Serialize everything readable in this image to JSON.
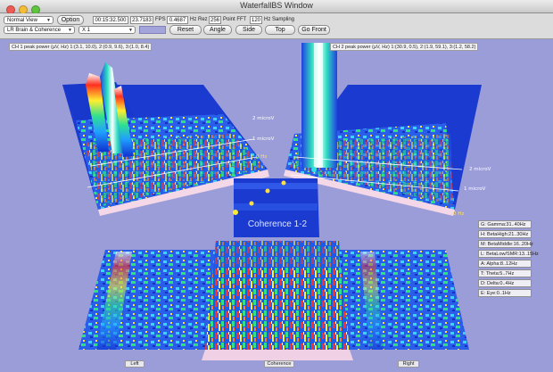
{
  "window": {
    "title": "WaterfallBS Window"
  },
  "toolbar": {
    "view_select": "Normal View",
    "option_button": "Option",
    "mode_select": "LR Brain & Coherence",
    "scale_select": "X 1",
    "time": "00:15:32.500",
    "fps_value": "23.7183",
    "fps_label": "FPS",
    "hz_rez_value": "0.4687",
    "hz_rez_label": "Hz Rez",
    "point_fft_value": "256",
    "point_fft_label": "Point FFT",
    "sampling_value": "120",
    "sampling_label": "Hz Sampling",
    "reset_button": "Reset",
    "angle_button": "Angle",
    "side_button": "Side",
    "top_button": "Top",
    "go_front_button": "Go Front"
  },
  "channels": {
    "ch1_label": "CH 1 peak power (µV, Hz) 1:(3.1, 10.0), 2:(0.9, 9.6), 3:(1.0, 8.4)",
    "ch2_label": "CH 2 peak power (µV, Hz) 1:(30.9, 0.5), 2:(1.9, 59.1), 3:(1.2, 58.2)"
  },
  "axis": {
    "left_2": "2 microV",
    "left_1": "1 microV",
    "left_0": "0 Hz",
    "right_2": "2 microV",
    "right_1": "1 microV",
    "right_0": "0 Hz"
  },
  "coherence": {
    "title": "Coherence 1-2"
  },
  "legend": [
    "G: Gamma:31..40Hz",
    "H: BetaHigh:21..30Hz",
    "M: BetaMiddle:16..20Hz",
    "L: BetaLow/SMR:13..15Hz",
    "A: Alpha:8..12Hz",
    "T: Theta:5..7Hz",
    "D: Delta:0..4Hz",
    "E: Eye:0..1Hz"
  ],
  "bottom_labels": {
    "left": "Left",
    "center": "Coherence",
    "right": "Right"
  },
  "colors": {
    "background": "#9b9dd8",
    "panel_blue": "#1f3fd8"
  }
}
